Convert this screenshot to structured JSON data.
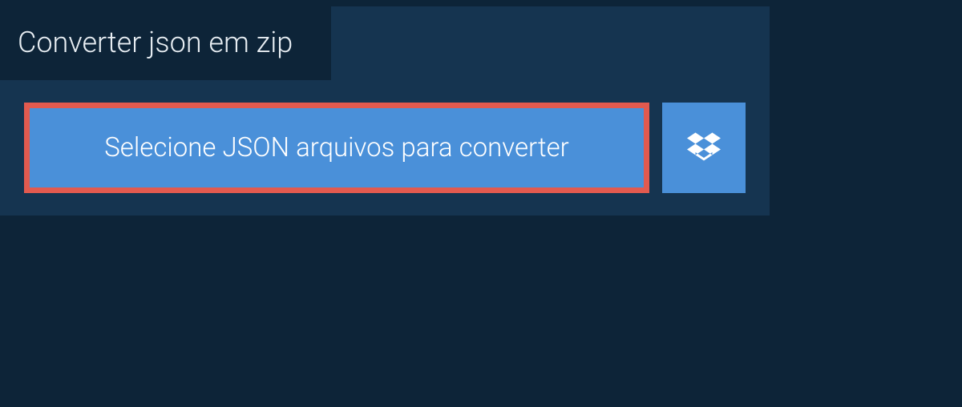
{
  "tab": {
    "title": "Converter json em zip"
  },
  "actions": {
    "select_label": "Selecione JSON arquivos para converter"
  }
}
